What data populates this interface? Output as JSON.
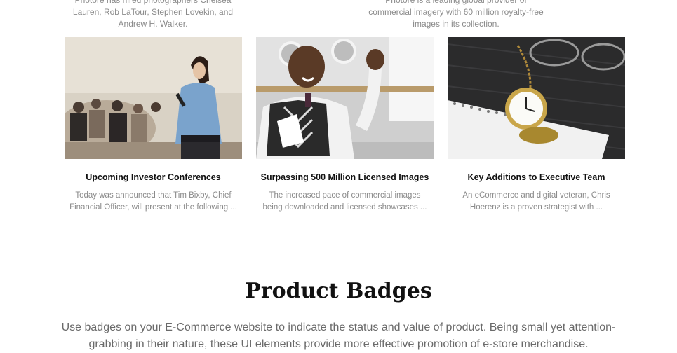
{
  "top_snippets": {
    "left": "Photore has hired photographers Chelsea Lauren, Rob LaTour, Stephen Lovekin, and Andrew H. Walker.",
    "right": "Photore is a leading global provider of commercial imagery with 60 million royalty-free images in its collection."
  },
  "news": [
    {
      "title": "Upcoming Investor Conferences",
      "excerpt": "Today was announced that Tim Bixby, Chief Financial Officer, will present at the following ..."
    },
    {
      "title": "Surpassing 500 Million Licensed Images",
      "excerpt": "The increased pace of commercial images being downloaded and licensed showcases ..."
    },
    {
      "title": "Key Additions to Executive Team",
      "excerpt": "An eCommerce and digital veteran, Chris Hoerenz is a proven strategist with ..."
    }
  ],
  "badges_section": {
    "title": "Product Badges",
    "description": "Use badges on your E-Commerce website to indicate the status and value of product. Being small yet attention-grabbing in their nature, these UI elements provide more effective promotion of e-store merchandise."
  }
}
